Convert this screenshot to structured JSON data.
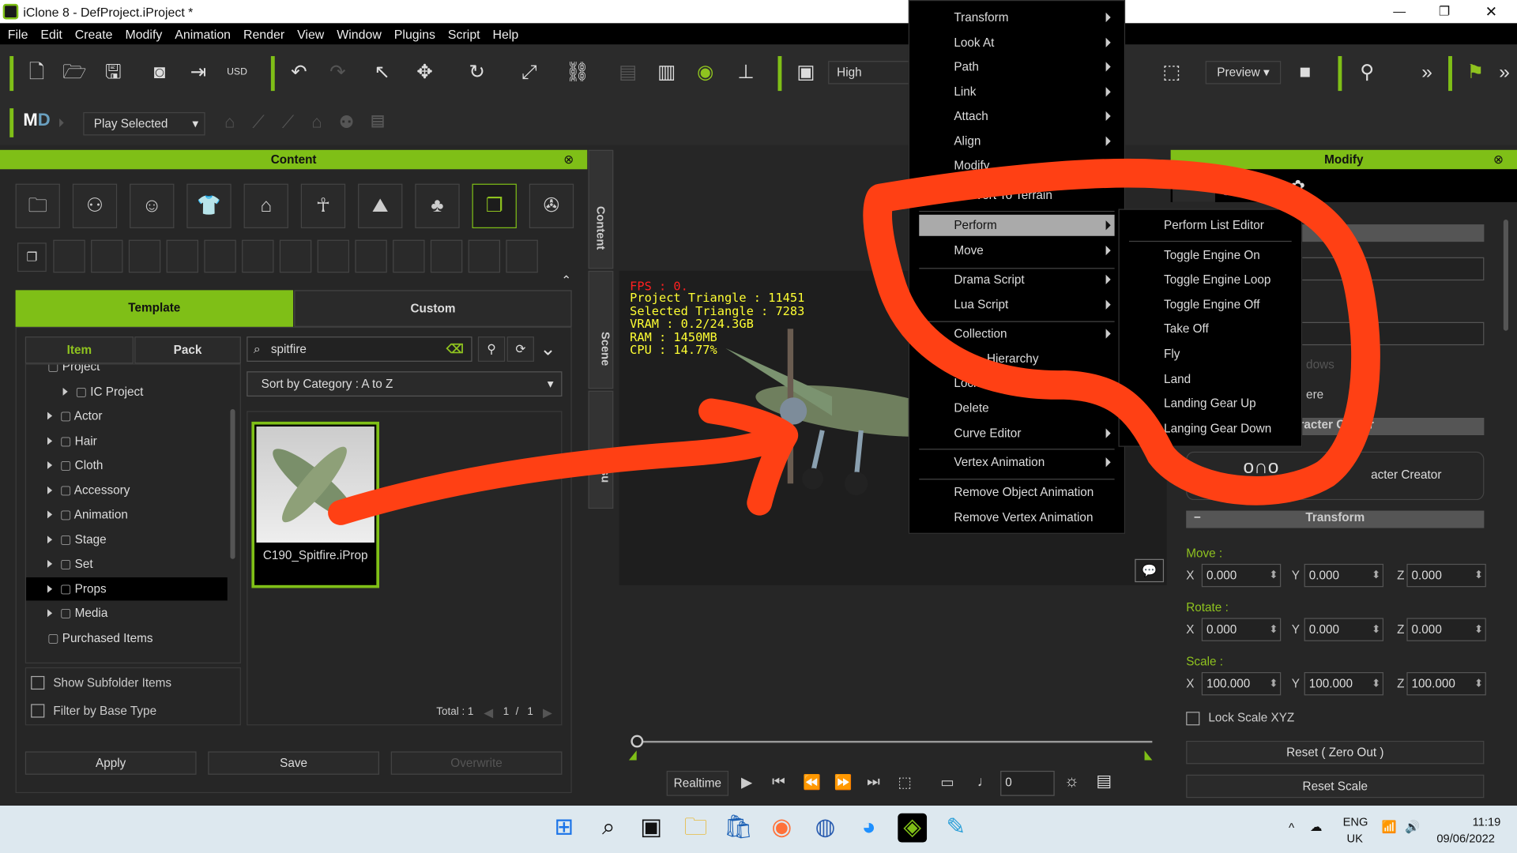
{
  "window": {
    "title": "iClone 8 - DefProject.iProject *",
    "minimize": "—",
    "restore": "❐",
    "close": "✕"
  },
  "menubar": [
    "File",
    "Edit",
    "Create",
    "Modify",
    "Animation",
    "Render",
    "View",
    "Window",
    "Plugins",
    "Script",
    "Help"
  ],
  "toolbar": {
    "quality": "High",
    "preview": "Preview",
    "play_mode": "Play Selected",
    "more": "»"
  },
  "content": {
    "title": "Content",
    "tabs": {
      "template": "Template",
      "custom": "Custom"
    },
    "subtabs": {
      "item": "Item",
      "pack": "Pack"
    },
    "search_value": "spitfire",
    "sort": "Sort by Category : A to Z",
    "tree": [
      {
        "label": "Project",
        "partial": true
      },
      {
        "label": "IC Project"
      },
      {
        "label": "Actor"
      },
      {
        "label": "Hair"
      },
      {
        "label": "Cloth"
      },
      {
        "label": "Accessory"
      },
      {
        "label": "Animation"
      },
      {
        "label": "Stage"
      },
      {
        "label": "Set"
      },
      {
        "label": "Props",
        "selected": true
      },
      {
        "label": "Media"
      },
      {
        "label": "Purchased Items"
      }
    ],
    "asset": {
      "label": "C190_Spitfire.iProp"
    },
    "show_subfolder": "Show Subfolder Items",
    "filter_base": "Filter by Base Type",
    "total": "Total : 1",
    "page": "1",
    "page_sep": "/",
    "pages": "1",
    "buttons": {
      "apply": "Apply",
      "save": "Save",
      "overwrite": "Overwrite"
    }
  },
  "side_tabs": [
    "Content",
    "Scene",
    "Visu"
  ],
  "viewport": {
    "fps": "FPS : 0.",
    "stats": [
      "Project Triangle : 11451",
      "Selected Triangle : 7283",
      "VRAM : 0.2/24.3GB",
      "RAM : 1450MB",
      "CPU : 14.77%"
    ]
  },
  "timeline": {
    "realtime": "Realtime",
    "frame": "0"
  },
  "context_menu": [
    {
      "label": "Transform",
      "sub": true
    },
    {
      "label": "Look At",
      "sub": true
    },
    {
      "label": "Path",
      "sub": true
    },
    {
      "label": "Link",
      "sub": true
    },
    {
      "label": "Attach",
      "sub": true
    },
    {
      "label": "Align",
      "sub": true
    },
    {
      "label": "Modify",
      "sub": false
    },
    {
      "label": "Convert To Terrain",
      "sub": false
    },
    {
      "label": "Perform",
      "sub": true,
      "highlighted": true
    },
    {
      "label": "Move",
      "sub": true
    },
    {
      "label": "Drama Script",
      "sub": true
    },
    {
      "label": "Lua Script",
      "sub": true
    },
    {
      "label": "Collection",
      "sub": true
    },
    {
      "label": "Hierarchy",
      "sub": false
    },
    {
      "label": "Lock",
      "sub": false
    },
    {
      "label": "Delete",
      "sub": false
    },
    {
      "label": "Curve Editor",
      "sub": true
    },
    {
      "label": "Vertex Animation",
      "sub": true
    },
    {
      "label": "Remove Object Animation",
      "sub": false
    },
    {
      "label": "Remove Vertex Animation",
      "sub": false
    }
  ],
  "perform_submenu": [
    "Perform List Editor",
    "Toggle Engine On",
    "Toggle Engine Loop",
    "Toggle Engine Off",
    "Take Off",
    "Fly",
    "Land",
    "Landing Gear Up",
    "Langing Gear Down"
  ],
  "modify": {
    "title": "Modify",
    "partial": {
      "pr": "Pr",
      "dows": "dows",
      "ere": "ere",
      "char_head": "aracter C     or",
      "char_btn": "acter Creator"
    },
    "transform": "Transform",
    "move": "Move :",
    "rotate": "Rotate :",
    "scale": "Scale :",
    "axes": [
      "X",
      "Y",
      "Z"
    ],
    "move_vals": [
      "0.000",
      "0.000",
      "0.000"
    ],
    "rotate_vals": [
      "0.000",
      "0.000",
      "0.000"
    ],
    "scale_vals": [
      "100.000",
      "100.000",
      "100.000"
    ],
    "lock_scale": "Lock Scale XYZ",
    "reset_zero": "Reset ( Zero Out )",
    "reset_scale": "Reset Scale"
  },
  "taskbar": {
    "lang": "ENG",
    "region": "UK",
    "time": "11:19",
    "date": "09/06/2022"
  },
  "colors": {
    "accent": "#7fbf17",
    "annotation": "#ff4014",
    "stats": "#ffff33",
    "fps": "#ff2020"
  }
}
